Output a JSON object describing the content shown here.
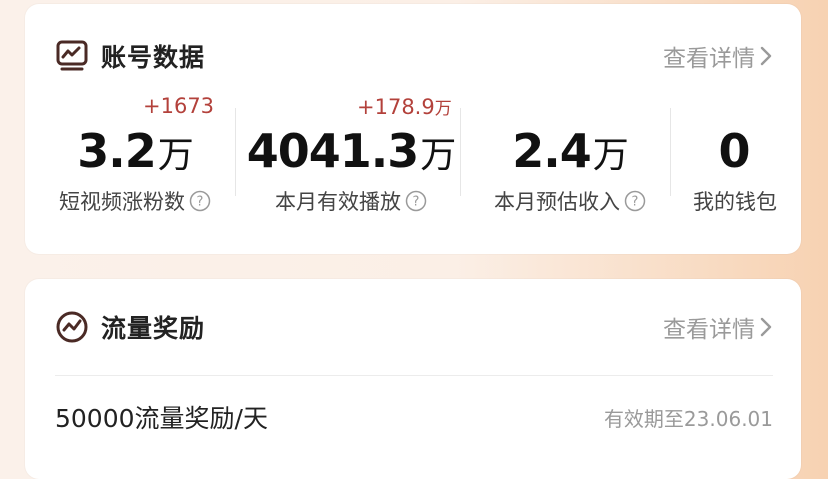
{
  "account_card": {
    "title": "账号数据",
    "detail_link": "查看详情",
    "stats": [
      {
        "delta": "+1673",
        "delta_unit": "",
        "value": "3.2",
        "value_unit": "万",
        "label": "短视频涨粉数"
      },
      {
        "delta": "+178.9",
        "delta_unit": "万",
        "value": "4041.3",
        "value_unit": "万",
        "label": "本月有效播放"
      },
      {
        "delta": "",
        "delta_unit": "",
        "value": "2.4",
        "value_unit": "万",
        "label": "本月预估收入"
      },
      {
        "delta": "",
        "delta_unit": "",
        "value": "0",
        "value_unit": "",
        "label": "我的钱包"
      }
    ]
  },
  "traffic_card": {
    "title": "流量奖励",
    "detail_link": "查看详情",
    "reward_name": "50000流量奖励/天",
    "reward_expire": "有效期至23.06.01"
  },
  "icons": {
    "account": "chart-monitor-icon",
    "traffic": "traffic-trend-icon",
    "help": "question-circle-icon",
    "chevron": "chevron-right-icon"
  },
  "colors": {
    "delta": "#b3413b",
    "icon": "#4a2a25",
    "muted": "#9a9a9a"
  }
}
